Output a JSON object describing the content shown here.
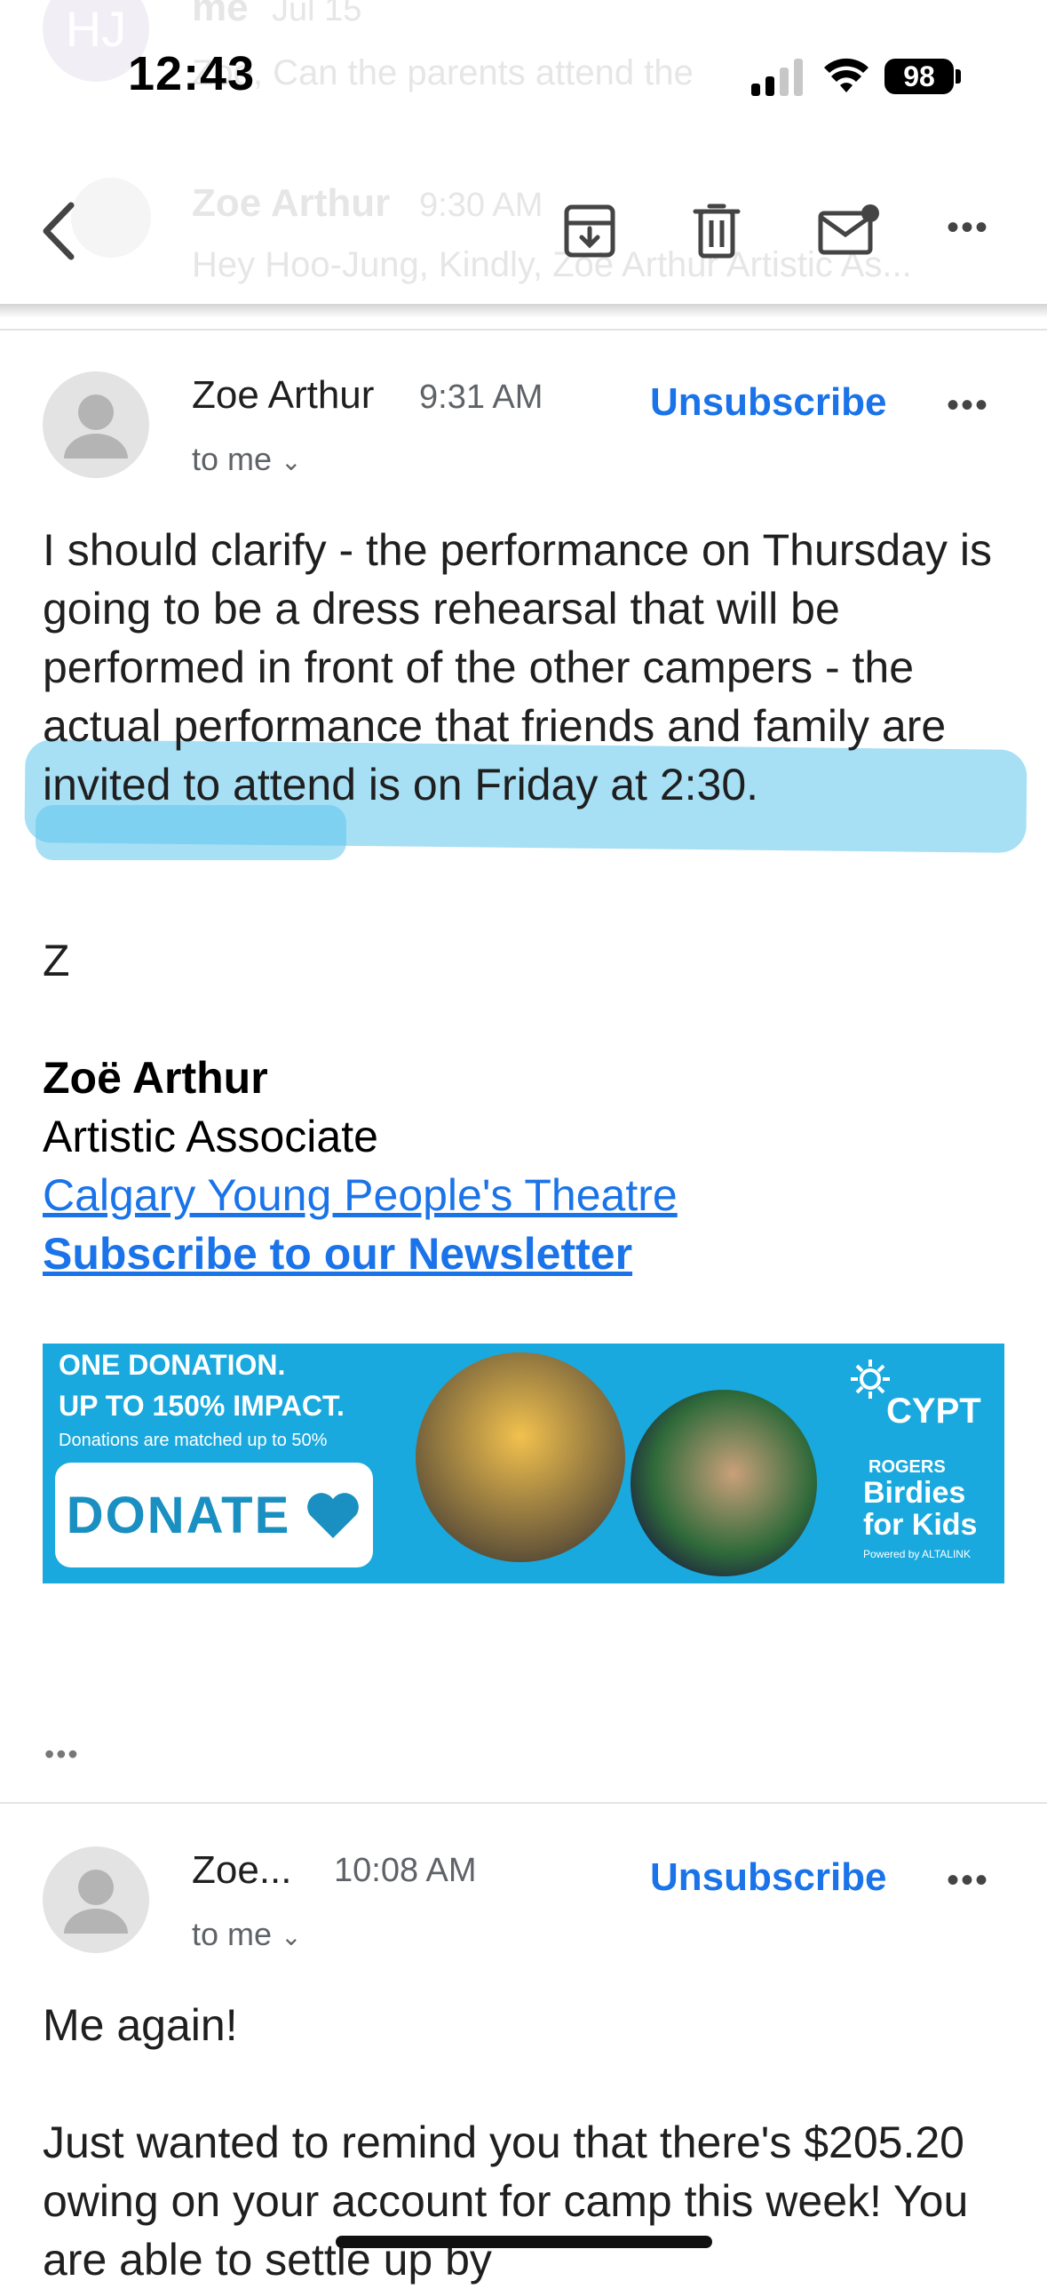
{
  "ghost": {
    "avatar_initials": "HJ",
    "row1_sender": "me",
    "row1_date": "Jul 15",
    "row1_preview": "Zoe, Can the parents attend the",
    "row2_sender": "Zoe Arthur",
    "row2_time": "9:30 AM",
    "row2_preview": "Hey Hoo-Jung, Kindly, Zoë Arthur Artistic As..."
  },
  "status_bar": {
    "time": "12:43",
    "battery": "98"
  },
  "toolbar": {
    "icons": [
      "back-icon",
      "archive-icon",
      "trash-icon",
      "mark-unread-icon",
      "more-icon"
    ],
    "more_label": "•••"
  },
  "message1": {
    "sender": "Zoe Arthur",
    "time": "9:31 AM",
    "recipient": "to me",
    "unsubscribe": "Unsubscribe",
    "more_label": "•••",
    "body": "I should clarify - the performance on Thursday is going to be a dress rehearsal that will be performed in front of the other campers - the actual performance that friends and family are invited to attend is on Friday at 2:30.",
    "signoff": "Z",
    "signature": {
      "name": "Zoë Arthur",
      "title": "Artistic Associate",
      "org_link": "Calgary Young People's Theatre",
      "newsletter_link": "Subscribe to our Newsletter"
    },
    "banner": {
      "line1": "ONE DONATION.",
      "line2": "UP TO 150% IMPACT.",
      "line3": "Donations are matched up to 50%",
      "donate": "DONATE",
      "logo": "CYPT",
      "sponsor_small": "ROGERS",
      "sponsor_line1": "Birdies",
      "sponsor_line2": "for Kids",
      "powered": "Powered by ALTALINK"
    },
    "collapsed_quote": "•••"
  },
  "message2": {
    "sender": "Zoe...",
    "time": "10:08 AM",
    "recipient": "to me",
    "unsubscribe": "Unsubscribe",
    "more_label": "•••",
    "body_line1": "Me again!",
    "body_para": "Just wanted to remind you that there's $205.20 owing on your account for camp this week! You are able to settle up by"
  }
}
